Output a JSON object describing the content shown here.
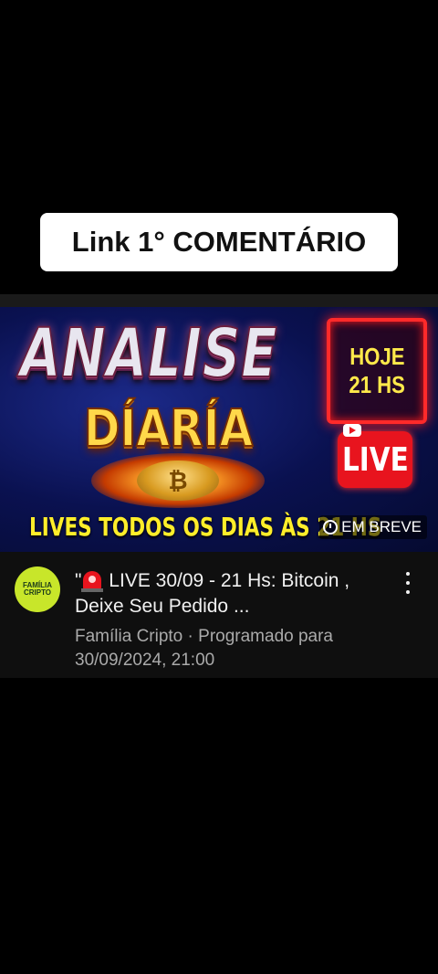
{
  "overlay": {
    "banner_text": "Link 1° COMENTÁRIO"
  },
  "thumbnail": {
    "title_line1": "ANALISE",
    "title_line2": "DÍARÍA",
    "coin_symbol": "₿",
    "hoje_line1": "HOJE",
    "hoje_line2": "21 HS",
    "live_badge": "LIVE",
    "bottom_text": "LIVES TODOS OS DIAS ÀS 21 HS",
    "status_badge": "EM BREVE"
  },
  "video": {
    "channel_avatar_line1": "FAMÍLIA",
    "channel_avatar_line2": "CRIPTO",
    "title_prefix": "\"",
    "title_rest": " LIVE  30/09 - 21  Hs: Bitcoin ,  Deixe Seu Pedido ...",
    "channel_name": "Família Cripto",
    "separator": " · ",
    "scheduled_text": "Programado para 30/09/2024, 21:00"
  },
  "colors": {
    "background": "#000000",
    "thumb_bg": "#0a1150",
    "accent_red": "#e8141e",
    "accent_yellow": "#ffee2a"
  }
}
